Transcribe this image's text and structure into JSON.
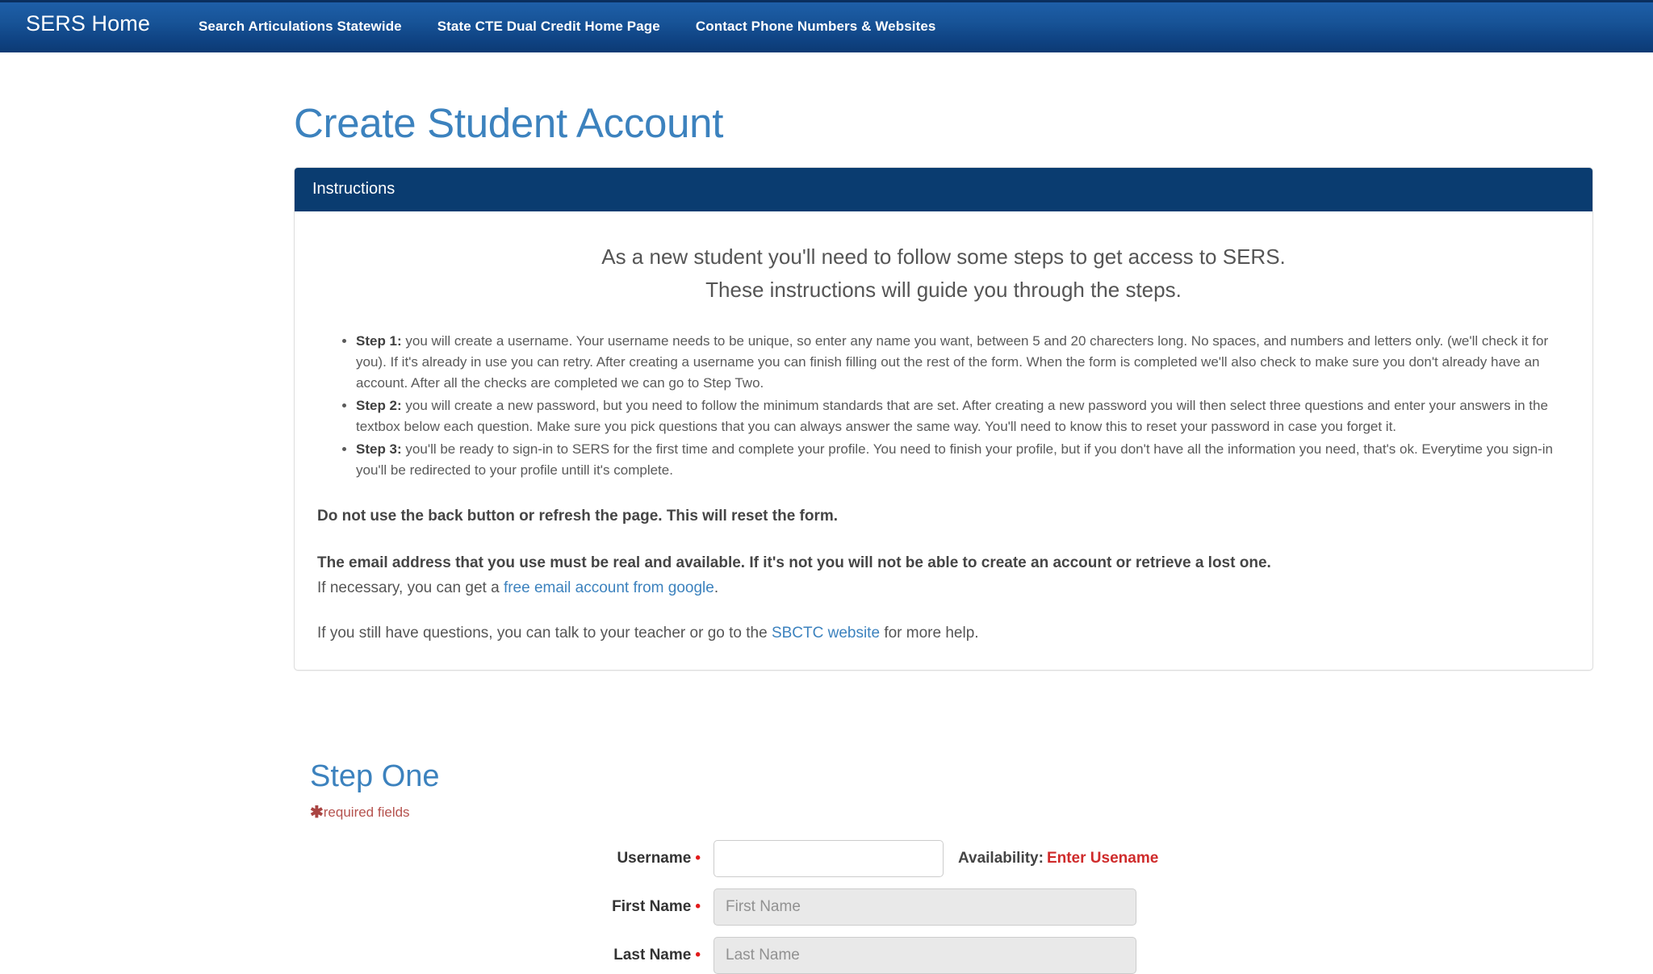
{
  "navbar": {
    "brand": "SERS Home",
    "links": [
      {
        "label": "Search Articulations Statewide"
      },
      {
        "label": "State CTE Dual Credit Home Page"
      },
      {
        "label": "Contact Phone Numbers & Websites"
      }
    ]
  },
  "page": {
    "title": "Create Student Account"
  },
  "instructions": {
    "panel_title": "Instructions",
    "lead_line_1": "As a new student you'll need to follow some steps to get access to SERS.",
    "lead_line_2": "These instructions will guide you through the steps.",
    "steps": [
      {
        "label": "Step 1:",
        "text": " you will create a username. Your username needs to be unique, so enter any name you want, between 5 and 20 charecters long. No spaces, and numbers and letters only. (we'll check it for you). If it's already in use you can retry. After creating a username you can finish filling out the rest of the form. When the form is completed we'll also check to make sure you don't already have an account. After all the checks are completed we can go to Step Two."
      },
      {
        "label": "Step 2:",
        "text": " you will create a new password, but you need to follow the minimum standards that are set. After creating a new password you will then select three questions and enter your answers in the textbox below each question. Make sure you pick questions that you can always answer the same way. You'll need to know this to reset your password in case you forget it."
      },
      {
        "label": "Step 3:",
        "text": " you'll be ready to sign-in to SERS for the first time and complete your profile. You need to finish your profile, but if you don't have all the information you need, that's ok. Everytime you sign-in you'll be redirected to your profile untill it's complete."
      }
    ],
    "warning_back_button": "Do not use the back button or refresh the page. This will reset the form.",
    "warning_email": "The email address that you use must be real and available. If it's not you will not be able to create an account or retrieve a lost one.",
    "email_help_prefix": "If necessary, you can get a ",
    "email_help_link": "free email account from google",
    "email_help_suffix": ".",
    "questions_prefix": "If you still have questions, you can talk to your teacher or go to the ",
    "questions_link": "SBCTC website",
    "questions_suffix": " for more help."
  },
  "step_one": {
    "heading": "Step One",
    "required_note": "required fields",
    "required_marker": "✱",
    "fields": [
      {
        "label": "Username",
        "value": "",
        "placeholder": "",
        "required_dot": "•",
        "disabled": false
      },
      {
        "label": "First Name",
        "value": "",
        "placeholder": "First Name",
        "required_dot": "•",
        "disabled": true
      },
      {
        "label": "Last Name",
        "value": "",
        "placeholder": "Last Name",
        "required_dot": "•",
        "disabled": true
      }
    ],
    "availability_label": "Availability:",
    "availability_status": "Enter Usename"
  },
  "colors": {
    "navbar_blue": "#175397",
    "panel_header_navy": "#0a3c70",
    "heading_blue": "#3c82be",
    "link_blue": "#3c82be",
    "required_red": "#b5524e",
    "status_red": "#cf2b2b",
    "disabled_grey": "#e9e9e9"
  }
}
